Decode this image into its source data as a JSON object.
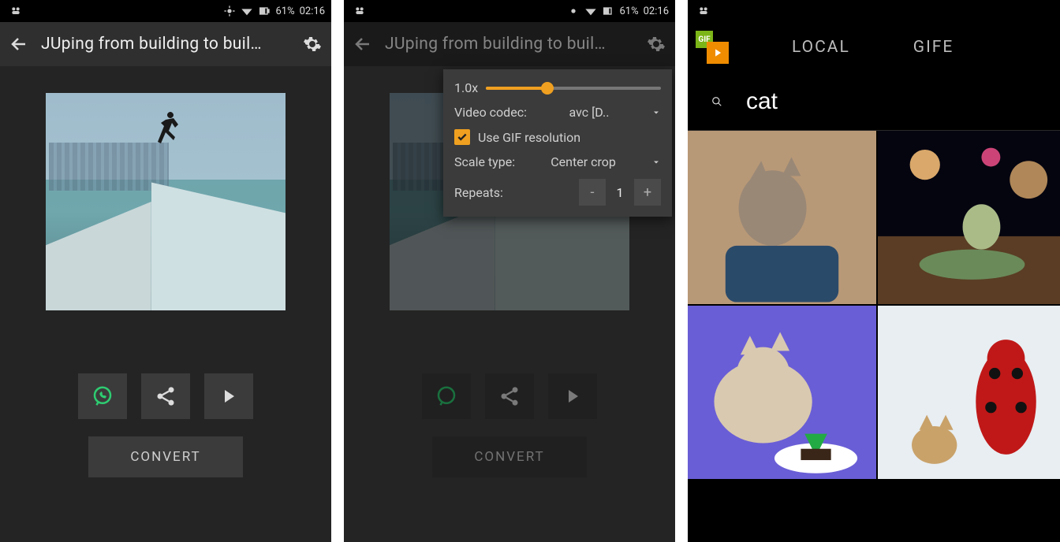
{
  "status": {
    "battery": "61%",
    "time": "02:16"
  },
  "screen1": {
    "title": "JUping from building to buil…",
    "actions": {
      "convert": "CONVERT"
    }
  },
  "screen2": {
    "title": "JUping from building to buil…",
    "settings": {
      "speed_label": "1.0x",
      "codec_label": "Video codec:",
      "codec_value": "avc [D..",
      "use_gif_res": "Use GIF resolution",
      "scale_label": "Scale type:",
      "scale_value": "Center crop",
      "repeats_label": "Repeats:",
      "repeats_value": "1"
    },
    "actions": {
      "convert": "CONVERT"
    }
  },
  "screen3": {
    "tabs": {
      "local": "LOCAL",
      "gifer": "GIFE"
    },
    "search": {
      "value": "cat"
    },
    "logo_gif": "GIF"
  }
}
